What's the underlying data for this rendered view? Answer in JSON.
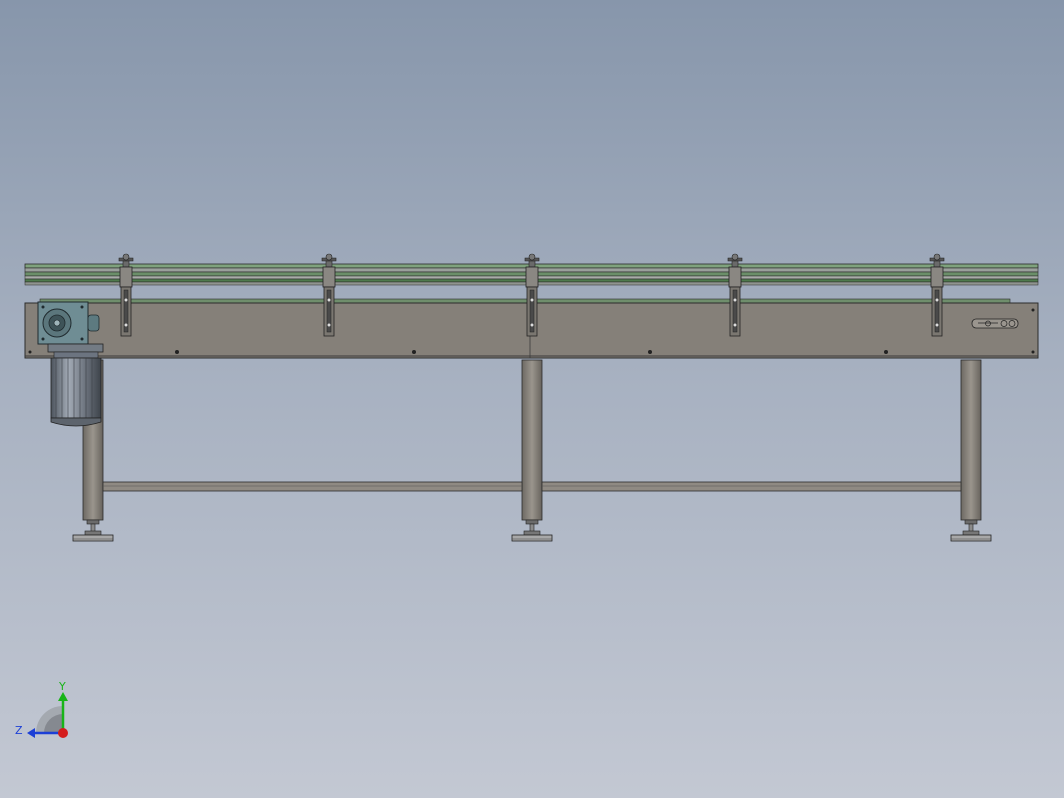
{
  "scene": {
    "colors": {
      "background_top": "#8796ab",
      "background_bottom": "#c3c8d3",
      "frame": "#858079",
      "belt_green": "#4e7a4c",
      "outline": "#2b2b2b",
      "motor": "#7d8590"
    },
    "model": {
      "name": "conveyor-assembly",
      "components": [
        "conveyor-frame",
        "guide-rails",
        "rail-brackets",
        "gear-reducer",
        "drive-motor",
        "support-legs",
        "cross-beams",
        "leveling-feet",
        "label-plate"
      ]
    },
    "triad": {
      "y_label": "Y",
      "z_label": "Z",
      "colors": {
        "y": "#18b418",
        "z": "#1c3fd6",
        "x": "#d41c1c"
      }
    }
  }
}
